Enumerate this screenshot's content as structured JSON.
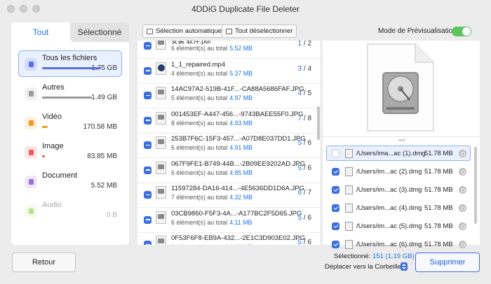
{
  "window": {
    "title": "4DDiG Duplicate File Deleter"
  },
  "tabs": {
    "all": "Tout",
    "selected": "Sélectionné"
  },
  "categories": [
    {
      "name": "Tous les fichiers",
      "size": "1.75 GB",
      "icon": "folder-icon",
      "color": "#5b6ee8",
      "fill": 1.0,
      "selected": true
    },
    {
      "name": "Autres",
      "size": "1.49 GB",
      "icon": "grid-icon",
      "color": "#9a9a9a",
      "fill": 0.85
    },
    {
      "name": "Vidéo",
      "size": "170.58 MB",
      "icon": "video-icon",
      "color": "#f39a1c",
      "fill": 0.1
    },
    {
      "name": "Image",
      "size": "83.85 MB",
      "icon": "image-icon",
      "color": "#ef5a5a",
      "fill": 0.05
    },
    {
      "name": "Document",
      "size": "5.52 MB",
      "icon": "document-icon",
      "color": "#9b6be0",
      "fill": 0.0
    },
    {
      "name": "Audio",
      "size": "0 B",
      "icon": "microphone-icon",
      "color": "#b6df8a",
      "fill": 0.0,
      "disabled": true
    }
  ],
  "toolbar": {
    "auto_select": "Sélection automatique",
    "deselect_all": "Tout déselectionner",
    "preview_mode": "Mode de Prévisualisation",
    "preview_on": true
  },
  "groups": [
    {
      "name": "安装 软件.pdf",
      "count_text": "6 élément(s) au total",
      "size": "5.52 MB",
      "sel": "1",
      "total": "2",
      "type": "doc"
    },
    {
      "name": "1_1_repaired.mp4",
      "count_text": "4 élément(s) au total",
      "size": "5.37 MB",
      "sel": "3",
      "total": "4",
      "type": "vid"
    },
    {
      "name": "14AC97A2-519B-41F...-CA88A5686FAF.JPG",
      "count_text": "5 élément(s) au total",
      "size": "4.97 MB",
      "sel": "4",
      "total": "5",
      "type": "img"
    },
    {
      "name": "001453EF-A447-456...-9743BAEE55F0.JPG",
      "count_text": "8 élément(s) au total",
      "size": "4.93 MB",
      "sel": "7",
      "total": "8",
      "type": "img"
    },
    {
      "name": "253B7F6C-15F3-457...-A07D8E037DD1.JPG",
      "count_text": "6 élément(s) au total",
      "size": "4.91 MB",
      "sel": "5",
      "total": "6",
      "type": "img"
    },
    {
      "name": "067F9FE1-B749-44B...-2B09EE9202AD.JPG",
      "count_text": "6 élément(s) au total",
      "size": "4.85 MB",
      "sel": "5",
      "total": "6",
      "type": "img"
    },
    {
      "name": "11597284-DA16-414...-4E5636DD1D6A.JPG",
      "count_text": "7 élément(s) au total",
      "size": "4.32 MB",
      "sel": "6",
      "total": "7",
      "type": "img"
    },
    {
      "name": "03CB9860-F5F3-4A...-A177BC2F5D65.JPG",
      "count_text": "6 élément(s) au total",
      "size": "4.11 MB",
      "sel": "5",
      "total": "6",
      "type": "img"
    },
    {
      "name": "0F53F6F8-EB9A-432...-2E1C3D903E02.JPG",
      "count_text": "6 élément(s) au total",
      "size": "4.06 MB",
      "sel": "5",
      "total": "6",
      "type": "img"
    }
  ],
  "right_list": [
    {
      "path": "/Users/ima...ac (1).dmg",
      "size": "51.78 MB",
      "checked": false,
      "selected": true
    },
    {
      "path": "/Users/im...ac (2).dmg",
      "size": "51.78 MB",
      "checked": true
    },
    {
      "path": "/Users/im...ac (3).dmg",
      "size": "51.78 MB",
      "checked": true
    },
    {
      "path": "/Users/im...ac (4).dmg",
      "size": "51.78 MB",
      "checked": true
    },
    {
      "path": "/Users/im...ac (5).dmg",
      "size": "51.78 MB",
      "checked": true
    },
    {
      "path": "/Users/im...ac (6).dmg",
      "size": "51.78 MB",
      "checked": true
    }
  ],
  "footer": {
    "back": "Retour",
    "selected_label": "Sélectionné:",
    "selected_value": "151 (1.19 GB)",
    "destination": "Déplacer vers la Corbeille",
    "delete": "Supprimer"
  }
}
